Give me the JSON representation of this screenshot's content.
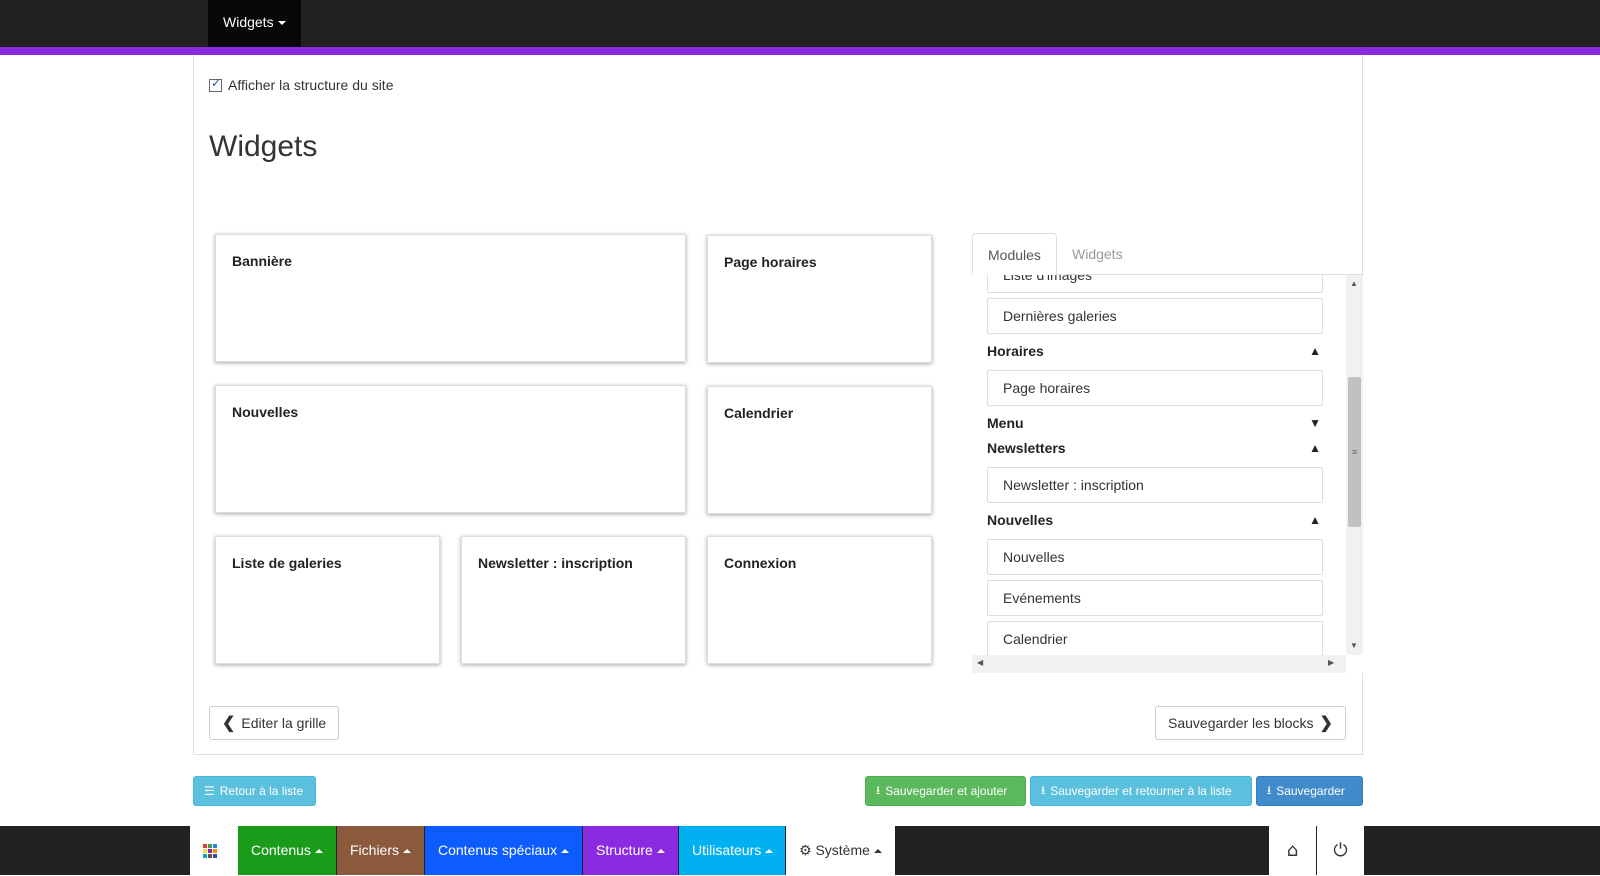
{
  "topnav": {
    "menu_label": "Widgets"
  },
  "panel": {
    "structure_label": "Afficher la structure du site",
    "title": "Widgets"
  },
  "blocks": {
    "banniere": "Bannière",
    "page_horaires": "Page horaires",
    "nouvelles": "Nouvelles",
    "calendrier": "Calendrier",
    "liste_galeries": "Liste de galeries",
    "newsletter": "Newsletter : inscription",
    "connexion": "Connexion"
  },
  "tabs": {
    "modules": "Modules",
    "widgets": "Widgets"
  },
  "modules": {
    "item_liste_images": "Liste d'images",
    "item_dernieres_galeries": "Dernières galeries",
    "group_horaires": "Horaires",
    "item_page_horaires": "Page horaires",
    "group_menu": "Menu",
    "group_newsletters": "Newsletters",
    "item_newsletter": "Newsletter : inscription",
    "group_nouvelles": "Nouvelles",
    "item_nouvelles": "Nouvelles",
    "item_evenements": "Evénements",
    "item_calendrier": "Calendrier"
  },
  "buttons": {
    "edit_grid": "Editer la grille",
    "save_blocks": "Sauvegarder les blocks",
    "back_list": "Retour à la liste",
    "save_add": "Sauvegarder et ajouter",
    "save_return": "Sauvegarder et retourner à la liste",
    "save": "Sauvegarder"
  },
  "bottomnav": {
    "contenus": "Contenus",
    "fichiers": "Fichiers",
    "contenus_speciaux": "Contenus spéciaux",
    "structure": "Structure",
    "utilisateurs": "Utilisateurs",
    "systeme": "Système"
  },
  "colors": {
    "accent": "#8a2be2",
    "contenus": "#1a9c1a",
    "fichiers": "#8b5a3c",
    "contenus_speciaux": "#0d5cff",
    "structure": "#8a2be2",
    "utilisateurs": "#00b0f0"
  },
  "icons": [
    "caret-down-icon",
    "checkbox-icon",
    "chevron-up-icon",
    "chevron-down-icon",
    "chevron-left-icon",
    "chevron-right-icon",
    "list-icon",
    "download-icon",
    "apps-grid-icon",
    "gear-icon",
    "home-icon",
    "power-icon"
  ]
}
